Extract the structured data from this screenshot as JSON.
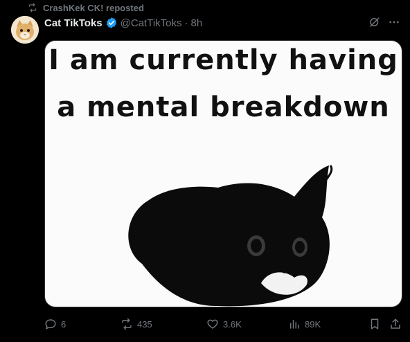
{
  "repost": {
    "text": "CrashKek CK! reposted",
    "icon": "repost-icon"
  },
  "author": {
    "display_name": "Cat TikToks",
    "handle": "@CatTikToks",
    "separator": "·",
    "time": "8h",
    "verified_color": "#1d9bf0"
  },
  "media": {
    "caption_line1": "I am currently having",
    "caption_line2": "a mental breakdown"
  },
  "actions": {
    "replies": "6",
    "reposts": "435",
    "likes": "3.6K",
    "views": "89K"
  },
  "colors": {
    "background": "#000000",
    "muted_text": "#71767b",
    "primary_text": "#e7e9ea",
    "accent": "#1d9bf0"
  }
}
